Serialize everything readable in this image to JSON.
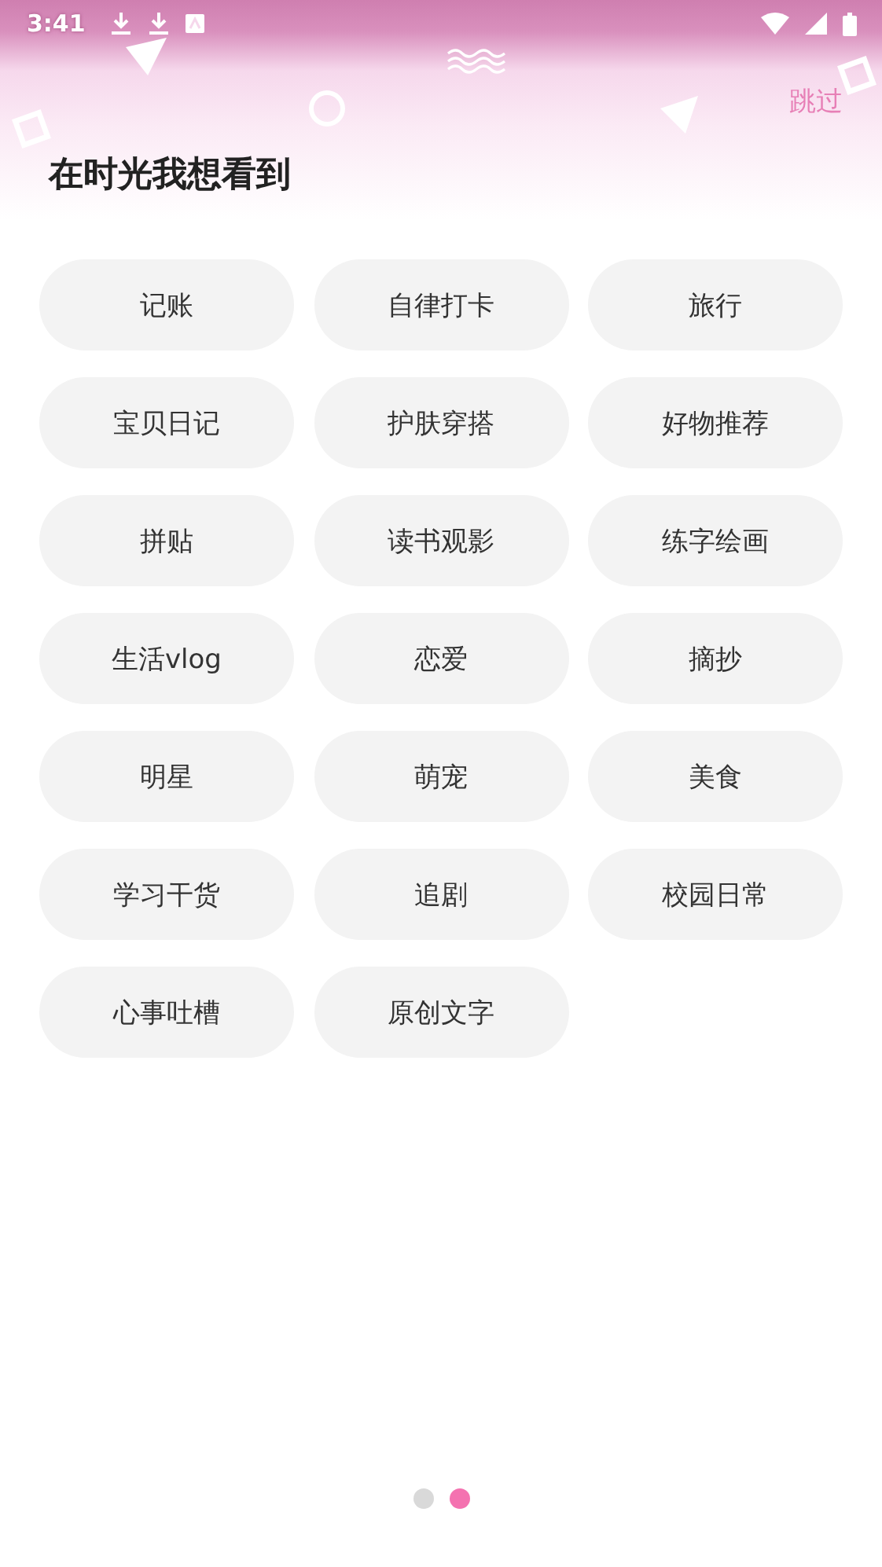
{
  "status_bar": {
    "time": "3:41"
  },
  "skip": "跳过",
  "title": "在时光我想看到",
  "tags": [
    {
      "label": "记账"
    },
    {
      "label": "自律打卡"
    },
    {
      "label": "旅行"
    },
    {
      "label": "宝贝日记"
    },
    {
      "label": "护肤穿搭"
    },
    {
      "label": "好物推荐"
    },
    {
      "label": "拼贴"
    },
    {
      "label": "读书观影"
    },
    {
      "label": "练字绘画"
    },
    {
      "label": "生活vlog"
    },
    {
      "label": "恋爱"
    },
    {
      "label": "摘抄"
    },
    {
      "label": "明星"
    },
    {
      "label": "萌宠"
    },
    {
      "label": "美食"
    },
    {
      "label": "学习干货"
    },
    {
      "label": "追剧"
    },
    {
      "label": "校园日常"
    },
    {
      "label": "心事吐槽"
    },
    {
      "label": "原创文字"
    }
  ],
  "pager": [
    {
      "selected": false
    },
    {
      "selected": true
    }
  ]
}
